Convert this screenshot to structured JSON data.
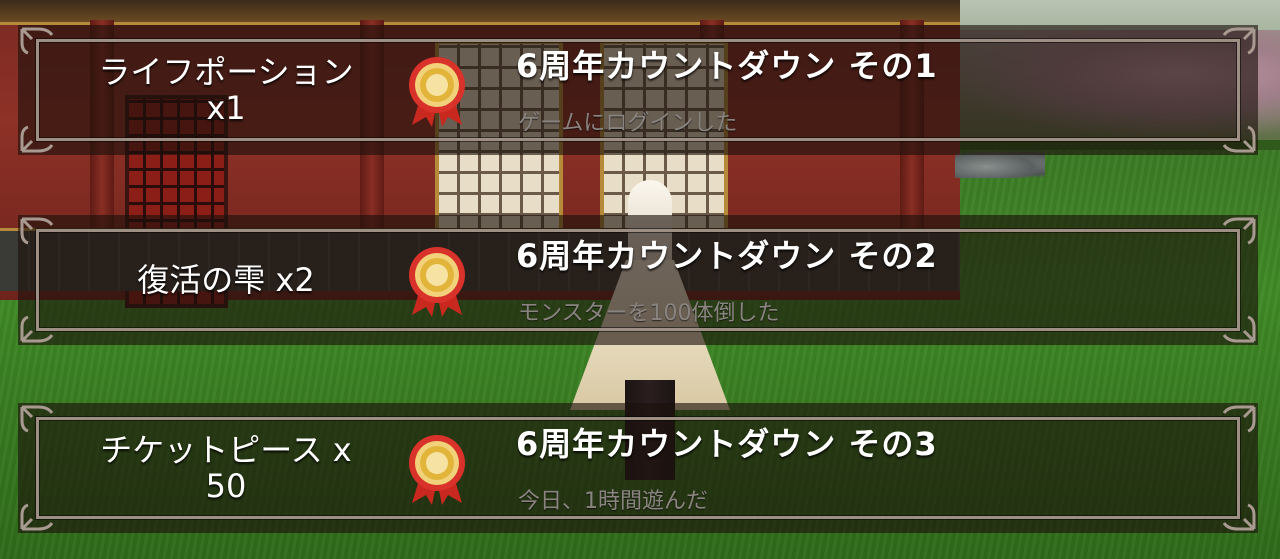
{
  "colors": {
    "panel_bg": "rgba(28,16,12,0.62)",
    "frame": "#9e8f85",
    "title_text": "#ffffff",
    "desc_text": "#8a8480",
    "medal_gold": "#e2b43a",
    "medal_ribbon": "#d8322a"
  },
  "quests": [
    {
      "reward_lines": [
        "ライフポーション",
        "x1"
      ],
      "title": "6周年カウントダウン その1",
      "description": "ゲームにログインした",
      "icon": "medal-icon"
    },
    {
      "reward_lines": [
        "復活の雫 x2",
        ""
      ],
      "title": "6周年カウントダウン その2",
      "description": "モンスターを100体倒した",
      "icon": "medal-icon"
    },
    {
      "reward_lines": [
        "チケットピース x",
        "50"
      ],
      "title": "6周年カウントダウン その3",
      "description": "今日、1時間遊んだ",
      "icon": "medal-icon"
    }
  ]
}
